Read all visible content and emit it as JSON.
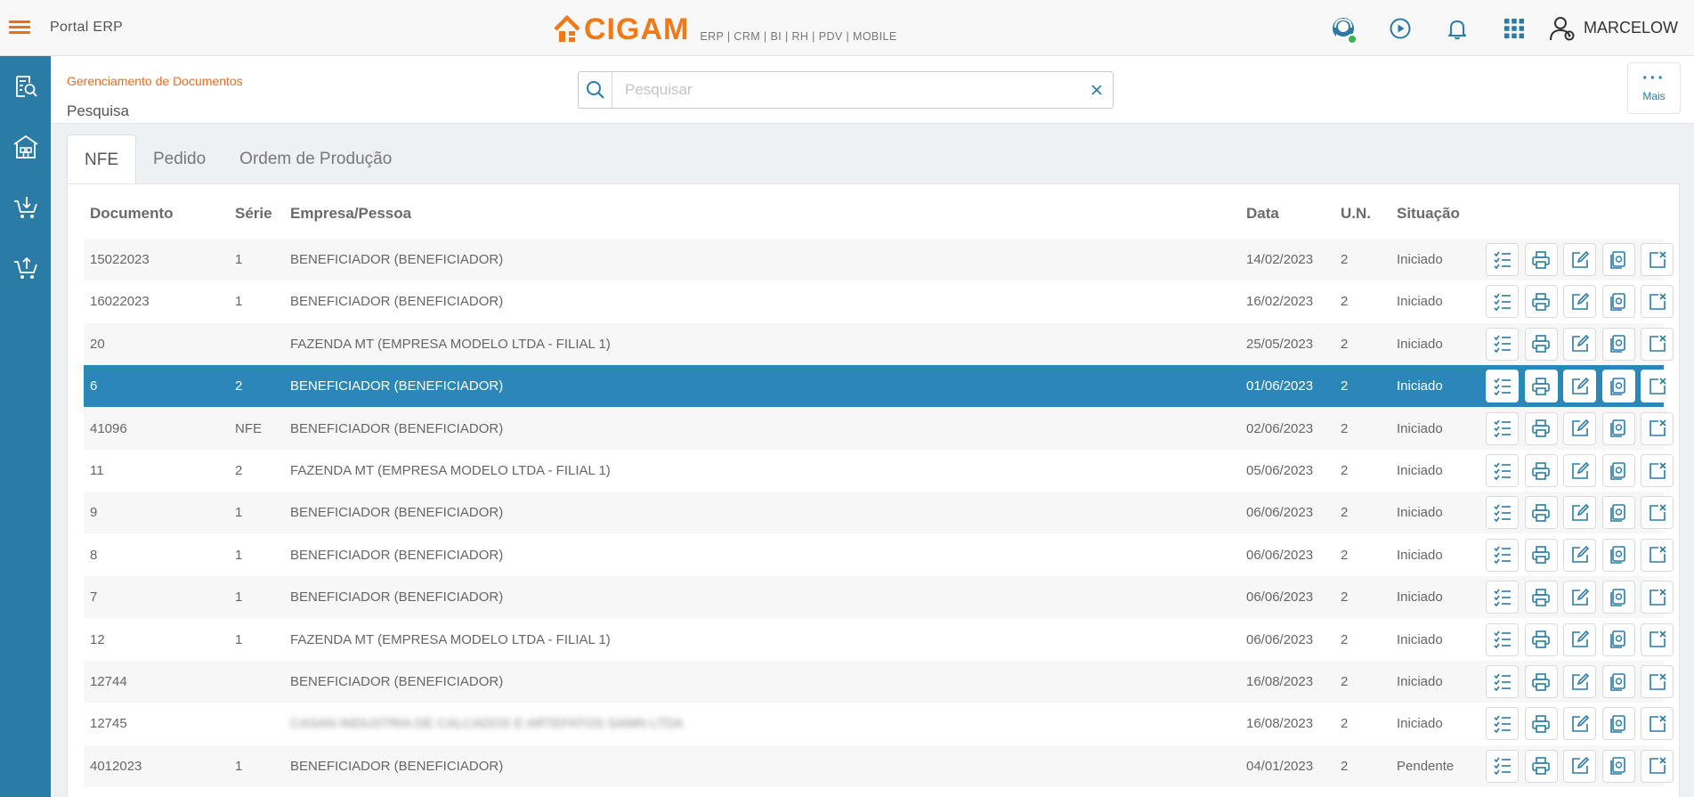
{
  "header": {
    "portal_title": "Portal ERP",
    "brand_name": "CIGAM",
    "brand_modules": "ERP | CRM | BI | RH | PDV | MOBILE",
    "user_name": "MARCELOW",
    "icons": [
      "menu-icon",
      "support-agent-icon",
      "play-icon",
      "bell-icon",
      "apps-grid-icon",
      "user-icon"
    ],
    "status_color": "#3cb44b"
  },
  "sidebar": {
    "items": [
      "document-search-icon",
      "warehouse-icon",
      "cart-download-icon",
      "cart-upload-icon"
    ]
  },
  "subheader": {
    "breadcrumb": "Gerenciamento de Documentos",
    "title": "Pesquisa",
    "search_placeholder": "Pesquisar",
    "search_value": "",
    "more_label": "Mais"
  },
  "tabs": [
    {
      "label": "NFE",
      "active": true
    },
    {
      "label": "Pedido",
      "active": false
    },
    {
      "label": "Ordem de Produção",
      "active": false
    }
  ],
  "table": {
    "columns": [
      "Documento",
      "Série",
      "Empresa/Pessoa",
      "Data",
      "U.N.",
      "Situação"
    ],
    "action_icons": [
      "checklist-icon",
      "print-icon",
      "edit-icon",
      "copy-document-icon",
      "cancel-icon"
    ],
    "rows": [
      {
        "documento": "15022023",
        "serie": "1",
        "empresa": "BENEFICIADOR (BENEFICIADOR)",
        "data": "14/02/2023",
        "un": "2",
        "situacao": "Iniciado"
      },
      {
        "documento": "16022023",
        "serie": "1",
        "empresa": "BENEFICIADOR (BENEFICIADOR)",
        "data": "16/02/2023",
        "un": "2",
        "situacao": "Iniciado"
      },
      {
        "documento": "20",
        "serie": "",
        "empresa": "FAZENDA MT (EMPRESA MODELO LTDA - FILIAL 1)",
        "data": "25/05/2023",
        "un": "2",
        "situacao": "Iniciado"
      },
      {
        "documento": "6",
        "serie": "2",
        "empresa": "BENEFICIADOR (BENEFICIADOR)",
        "data": "01/06/2023",
        "un": "2",
        "situacao": "Iniciado",
        "selected": true
      },
      {
        "documento": "41096",
        "serie": "NFE",
        "empresa": "BENEFICIADOR (BENEFICIADOR)",
        "data": "02/06/2023",
        "un": "2",
        "situacao": "Iniciado"
      },
      {
        "documento": "11",
        "serie": "2",
        "empresa": "FAZENDA MT (EMPRESA MODELO LTDA - FILIAL 1)",
        "data": "05/06/2023",
        "un": "2",
        "situacao": "Iniciado"
      },
      {
        "documento": "9",
        "serie": "1",
        "empresa": "BENEFICIADOR (BENEFICIADOR)",
        "data": "06/06/2023",
        "un": "2",
        "situacao": "Iniciado"
      },
      {
        "documento": "8",
        "serie": "1",
        "empresa": "BENEFICIADOR (BENEFICIADOR)",
        "data": "06/06/2023",
        "un": "2",
        "situacao": "Iniciado"
      },
      {
        "documento": "7",
        "serie": "1",
        "empresa": "BENEFICIADOR (BENEFICIADOR)",
        "data": "06/06/2023",
        "un": "2",
        "situacao": "Iniciado"
      },
      {
        "documento": "12",
        "serie": "1",
        "empresa": "FAZENDA MT (EMPRESA MODELO LTDA - FILIAL 1)",
        "data": "06/06/2023",
        "un": "2",
        "situacao": "Iniciado"
      },
      {
        "documento": "12744",
        "serie": "",
        "empresa": "BENEFICIADOR (BENEFICIADOR)",
        "data": "16/08/2023",
        "un": "2",
        "situacao": "Iniciado"
      },
      {
        "documento": "12745",
        "serie": "",
        "empresa": "CASAN INDUSTRIA DE CALCADOS E ARTEFATOS SAMN LTDA",
        "data": "16/08/2023",
        "un": "2",
        "situacao": "Iniciado",
        "blurred": true
      },
      {
        "documento": "4012023",
        "serie": "1",
        "empresa": "BENEFICIADOR (BENEFICIADOR)",
        "data": "04/01/2023",
        "un": "2",
        "situacao": "Pendente"
      }
    ]
  },
  "colors": {
    "accent_orange": "#ef6c1a",
    "primary_blue": "#2a7ca7",
    "selected_row": "#2a87b8"
  }
}
